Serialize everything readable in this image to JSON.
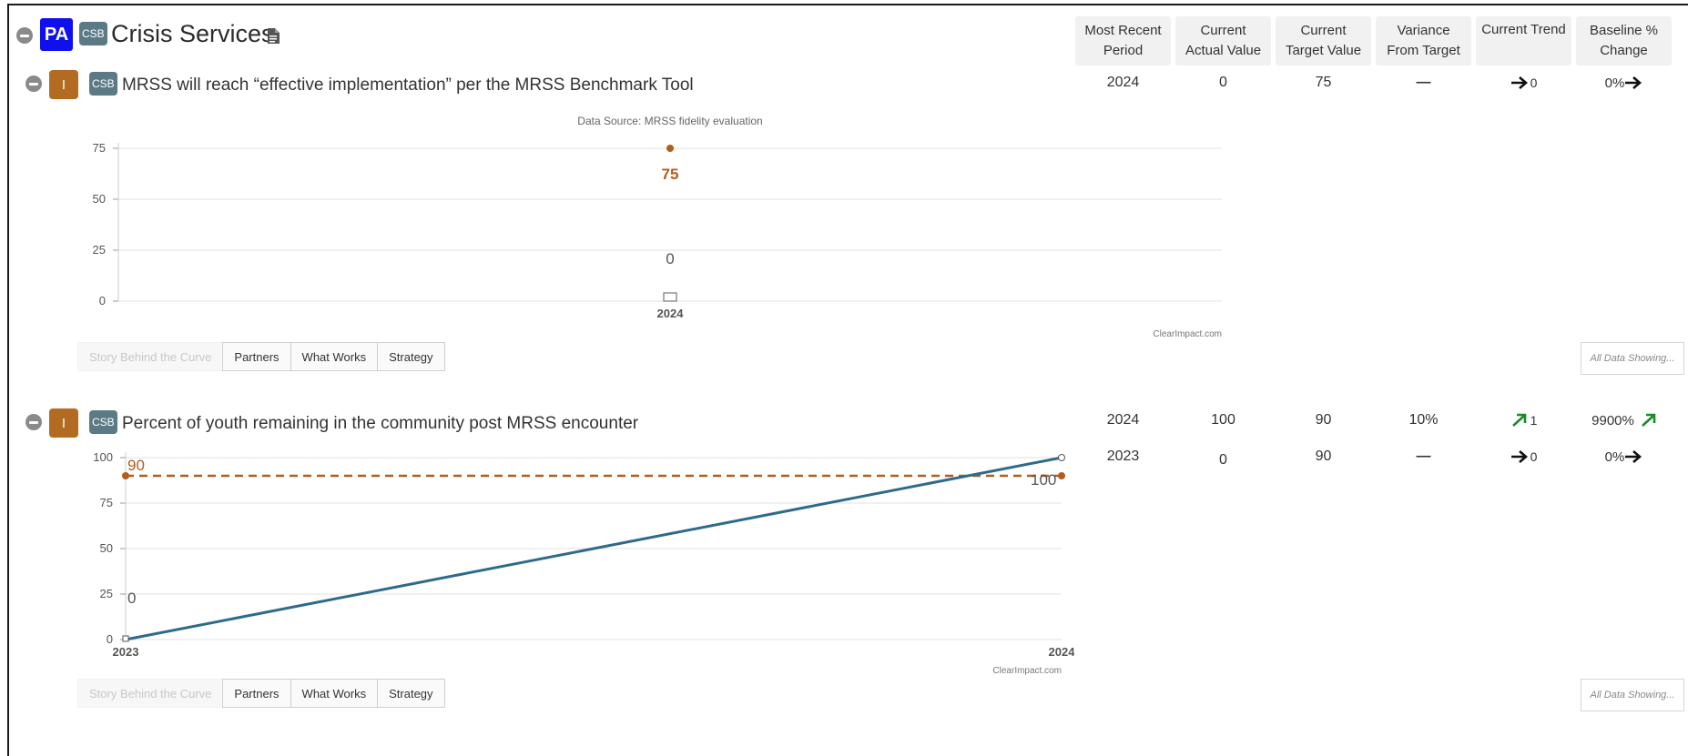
{
  "program": {
    "badge": "PA",
    "tag": "CSB",
    "title": "Crisis Services",
    "icon": "document-icon"
  },
  "columns": [
    "Most Recent\nPeriod",
    "Current\nActual Value",
    "Current\nTarget Value",
    "Variance\nFrom Target",
    "Current Trend",
    "Baseline %\nChange"
  ],
  "measures": [
    {
      "type_badge": "I",
      "tag": "CSB",
      "title": "MRSS will reach “effective implementation” per the MRSS Benchmark Tool",
      "rows": [
        {
          "period": "2024",
          "actual": "0",
          "target": "75",
          "variance": "—",
          "trend_value": "0",
          "trend_icon": "arrow-right-icon",
          "baseline": "0%",
          "baseline_icon": "arrow-right-icon"
        }
      ],
      "tabs": [
        "Story Behind the Curve",
        "Partners",
        "What Works",
        "Strategy"
      ],
      "showing_label": "All Data Showing..."
    },
    {
      "type_badge": "I",
      "tag": "CSB",
      "title": "Percent of youth remaining in the community post MRSS encounter",
      "rows": [
        {
          "period": "2024",
          "actual": "100",
          "target": "90",
          "variance": "10%",
          "trend_value": "1",
          "trend_icon": "arrow-up-right-icon",
          "baseline": "9900%",
          "baseline_icon": "arrow-up-right-icon"
        },
        {
          "period": "2023",
          "actual": "0",
          "target": "90",
          "variance": "—",
          "trend_value": "0",
          "trend_icon": "arrow-right-icon",
          "baseline": "0%",
          "baseline_icon": "arrow-right-icon"
        }
      ],
      "tabs": [
        "Story Behind the Curve",
        "Partners",
        "What Works",
        "Strategy"
      ],
      "showing_label": "All Data Showing..."
    }
  ],
  "colors": {
    "actual_line": "#2e6a8c",
    "target": "#b35c1e",
    "up_trend": "#1a8a2a",
    "grid": "#e0e0e0"
  },
  "chart_data": [
    {
      "type": "line",
      "title": "Data Source: MRSS fidelity evaluation",
      "credit": "ClearImpact.com",
      "x": [
        "2024"
      ],
      "ylim": [
        0,
        75
      ],
      "yticks": [
        0,
        25,
        50,
        75
      ],
      "series": [
        {
          "role": "actual",
          "values": [
            0
          ],
          "labels": [
            "0"
          ]
        },
        {
          "role": "target",
          "values": [
            75
          ],
          "labels": [
            "75"
          ]
        }
      ],
      "grid": true
    },
    {
      "type": "line",
      "title": "",
      "credit": "ClearImpact.com",
      "x": [
        "2023",
        "2024"
      ],
      "ylim": [
        0,
        100
      ],
      "yticks": [
        0,
        25,
        50,
        75,
        100
      ],
      "series": [
        {
          "role": "actual",
          "values": [
            0,
            100
          ],
          "labels": [
            "0",
            "100"
          ]
        },
        {
          "role": "target",
          "values": [
            90,
            90
          ],
          "labels": [
            "90",
            ""
          ]
        }
      ],
      "grid": true
    }
  ]
}
